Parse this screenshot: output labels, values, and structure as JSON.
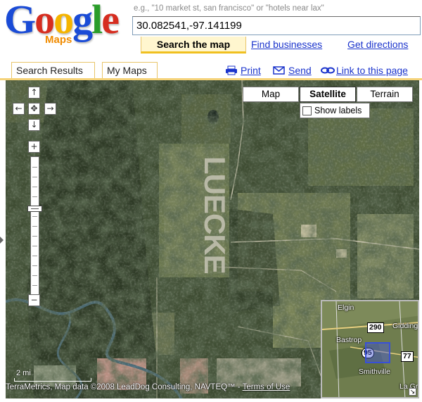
{
  "logo": {
    "letters": [
      "G",
      "o",
      "o",
      "g",
      "l",
      "e"
    ],
    "subtitle": "Maps",
    "colors": {
      "blue": "#1a4bd6",
      "red": "#d62d20",
      "yellow": "#f5b400",
      "green": "#2a9d2a",
      "orange": "#f08b00"
    }
  },
  "search": {
    "hint": "e.g., \"10 market st, san francisco\" or \"hotels near lax\"",
    "value": "30.082541,-97.141199"
  },
  "tabs": {
    "search_map": "Search the map",
    "find_businesses": "Find businesses",
    "get_directions": "Get directions"
  },
  "panel_tabs": {
    "search_results": "Search Results",
    "my_maps": "My Maps"
  },
  "actions": {
    "print": "Print",
    "send": "Send",
    "link": "Link to this page",
    "print_icon": "printer-icon",
    "send_icon": "envelope-icon",
    "link_icon": "chain-link-icon"
  },
  "map": {
    "types": {
      "map": "Map",
      "satellite": "Satellite",
      "terrain": "Terrain"
    },
    "selected_type": "Satellite",
    "show_labels": "Show labels",
    "show_labels_checked": false,
    "ground_text": "LUECKE",
    "scale": "2 mi",
    "attribution": "TerraMetrics, Map data ©2008 LeadDog Consulting, NAVTEQ™ - ",
    "terms_of_use": "Terms of Use"
  },
  "controls": {
    "pan_up": "↑",
    "pan_left": "←",
    "pan_right": "→",
    "pan_down": "↓",
    "pan_center": "✥",
    "zoom_in": "+",
    "zoom_out": "−",
    "zoom_level": 0.37
  },
  "overview": {
    "places": [
      "Elgin",
      "Giddings",
      "Bastrop",
      "Smithville",
      "La Gra"
    ],
    "shields": [
      "290",
      "95",
      "77"
    ]
  }
}
